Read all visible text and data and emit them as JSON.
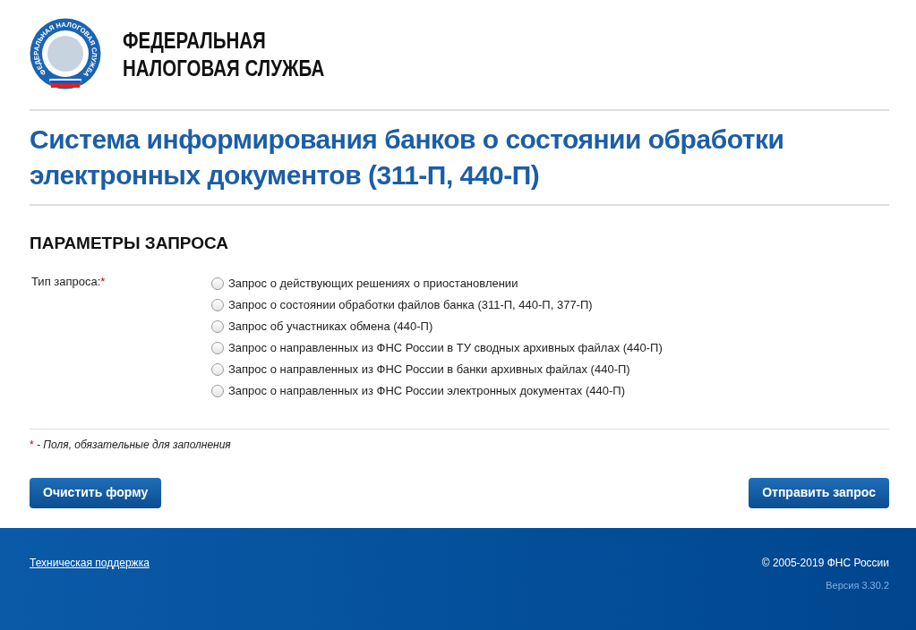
{
  "header": {
    "emblem_text": "ФЕДЕРАЛЬНАЯ НАЛОГОВАЯ СЛУЖБА",
    "org_name_lines": [
      "ФЕДЕРАЛЬНАЯ",
      "НАЛОГОВАЯ СЛУЖБА"
    ]
  },
  "page_title": "Система информирования банков о состоянии обработки электронных документов (311-П, 440-П)",
  "section_title": "ПАРАМЕТРЫ ЗАПРОСА",
  "form": {
    "label": "Тип запроса:",
    "required_mark": "*",
    "options": [
      {
        "label": "Запрос о действующих решениях о приостановлении",
        "selected": false
      },
      {
        "label": "Запрос о состоянии обработки файлов банка (311-П, 440-П, 377-П)",
        "selected": false
      },
      {
        "label": "Запрос об участниках обмена (440-П)",
        "selected": false
      },
      {
        "label": "Запрос о направленных из ФНС России в ТУ сводных архивных файлах (440-П)",
        "selected": false
      },
      {
        "label": "Запрос о направленных из ФНС России в банки архивных файлах (440-П)",
        "selected": false
      },
      {
        "label": "Запрос о направленных из ФНС России электронных документах (440-П)",
        "selected": false
      }
    ]
  },
  "required_note": {
    "mark": "*",
    "text": "- Поля, обязательные для заполнения"
  },
  "buttons": {
    "clear": "Очистить форму",
    "submit": "Отправить запрос"
  },
  "footer": {
    "support_link": "Техническая поддержка",
    "copyright": "© 2005-2019 ФНС России",
    "version": "Версия 3.30.2"
  }
}
